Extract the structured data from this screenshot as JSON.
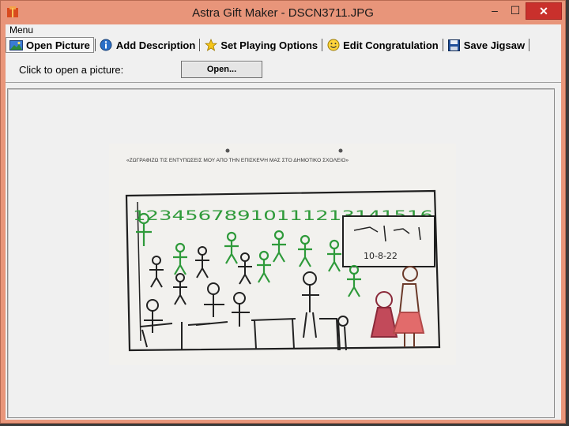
{
  "window": {
    "title": "Astra Gift Maker - DSCN3711.JPG",
    "close_glyph": "✕",
    "minimize_glyph": "–",
    "maximize_glyph": "☐"
  },
  "menu": {
    "label": "Menu"
  },
  "tabs": [
    {
      "label": "Open Picture",
      "icon": "picture-icon",
      "active": true
    },
    {
      "label": "Add Description",
      "icon": "info-icon",
      "active": false
    },
    {
      "label": "Set Playing Options",
      "icon": "star-icon",
      "active": false
    },
    {
      "label": "Edit Congratulation",
      "icon": "smiley-icon",
      "active": false
    },
    {
      "label": "Save Jigsaw",
      "icon": "floppy-icon",
      "active": false
    }
  ],
  "open_panel": {
    "prompt": "Click to open a picture:",
    "button_label": "Open..."
  },
  "picture": {
    "caption": "«ΖΩΓΡΑΦΙΖΩ ΤΙΣ ΕΝΤΥΠΩΣΕΙΣ ΜΟΥ ΑΠΟ ΤΗΝ ΕΠΙΣΚΕΨΗ ΜΑΣ ΣΤΟ ΔΗΜΟΤΙΚΟ ΣΧΟΛΕΙΟ»",
    "numbers": "12345678910111213141516",
    "board_text": "10-8-22"
  },
  "colors": {
    "titlebar": "#e8957a",
    "close_button": "#c9302c",
    "client_bg": "#f0f0f0"
  }
}
